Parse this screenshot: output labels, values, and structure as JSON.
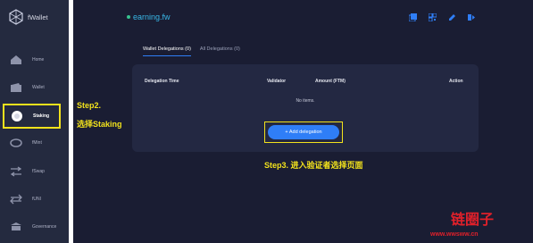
{
  "app": {
    "name": "fWallet"
  },
  "header": {
    "account_title": "earning.fw"
  },
  "sidebar": {
    "items": [
      {
        "label": "Home",
        "icon": "home-icon"
      },
      {
        "label": "Wallet",
        "icon": "wallet-icon"
      },
      {
        "label": "Staking",
        "icon": "staking-icon",
        "active": true
      },
      {
        "label": "fMint",
        "icon": "fmint-icon"
      },
      {
        "label": "fSwap",
        "icon": "fswap-icon"
      },
      {
        "label": "fUNI",
        "icon": "funi-icon"
      },
      {
        "label": "Governance",
        "icon": "governance-icon"
      }
    ]
  },
  "tabs": [
    {
      "label": "Wallet Delegations (0)",
      "active": true
    },
    {
      "label": "All Delegations (0)",
      "active": false
    }
  ],
  "table": {
    "columns": [
      "Delegation Time",
      "Validator",
      "Amount (FTM)",
      "Action"
    ],
    "empty_text": "No items.",
    "add_button": "+ Add delegation"
  },
  "annotations": {
    "step2_line1": "Step2.",
    "step2_line2": "选择Staking",
    "step3": "Step3. 进入验证者选择页面"
  },
  "watermark": {
    "text": "链圈子",
    "url": "www.wwsww.cn"
  },
  "colors": {
    "accent": "#2f7ef7",
    "highlight": "#f2e21c",
    "title": "#38b6e6",
    "watermark": "#e0202a"
  }
}
